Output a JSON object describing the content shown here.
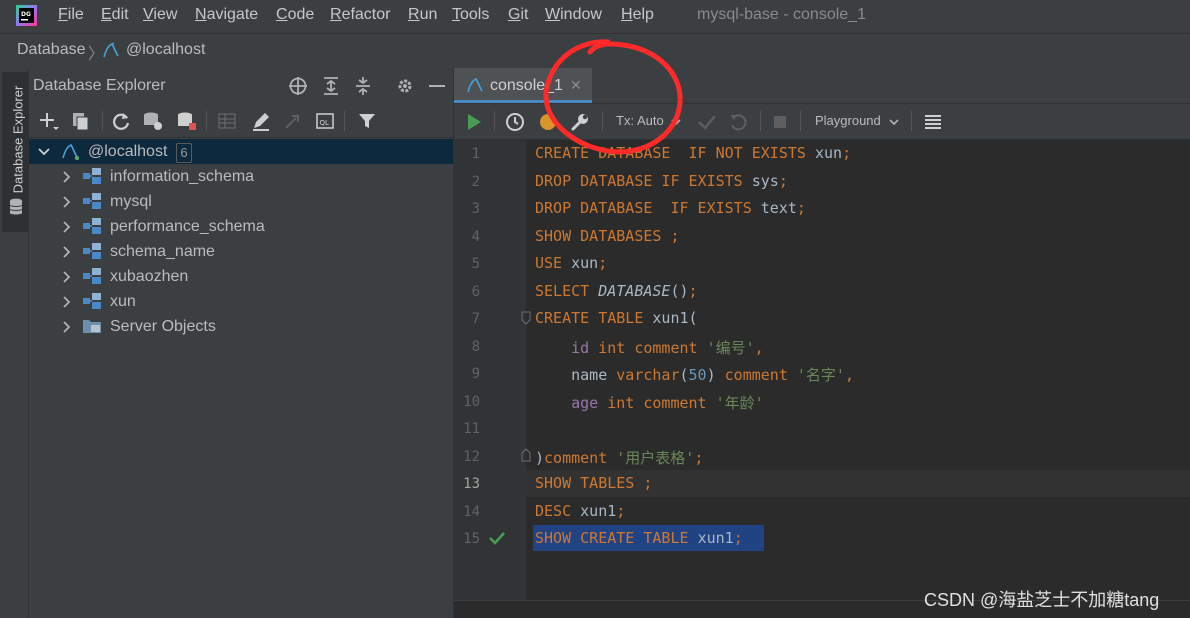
{
  "window": {
    "title": "mysql-base - console_1",
    "menu": [
      {
        "label": "File",
        "mn": "F",
        "rest": "ile"
      },
      {
        "label": "Edit",
        "mn": "E",
        "rest": "dit"
      },
      {
        "label": "View",
        "mn": "V",
        "rest": "iew"
      },
      {
        "label": "Navigate",
        "mn": "N",
        "rest": "avigate"
      },
      {
        "label": "Code",
        "mn": "C",
        "rest": "ode"
      },
      {
        "label": "Refactor",
        "mn": "R",
        "rest": "efactor"
      },
      {
        "label": "Run",
        "mn": "R",
        "rest": "un"
      },
      {
        "label": "Tools",
        "mn": "T",
        "rest": "ools"
      },
      {
        "label": "Git",
        "mn": "G",
        "rest": "it"
      },
      {
        "label": "Window",
        "mn": "W",
        "rest": "indow"
      },
      {
        "label": "Help",
        "mn": "H",
        "rest": "elp"
      }
    ]
  },
  "breadcrumb": {
    "database": "Database",
    "host": "@localhost"
  },
  "side_stripe": {
    "label": "Database Explorer"
  },
  "explorer": {
    "title": "Database Explorer",
    "root": {
      "label": "@localhost",
      "count": "6"
    },
    "items": [
      {
        "label": "information_schema"
      },
      {
        "label": "mysql"
      },
      {
        "label": "performance_schema"
      },
      {
        "label": "schema_name"
      },
      {
        "label": "xubaozhen"
      },
      {
        "label": "xun"
      },
      {
        "label": "Server Objects"
      }
    ]
  },
  "editor": {
    "tab_label": "console_1",
    "tx_mode": "Tx: Auto",
    "playground": "Playground",
    "current_line": 13,
    "lines": [
      {
        "n": "1",
        "segs": [
          [
            "kw",
            "CREATE DATABASE  IF NOT EXISTS "
          ],
          [
            "id",
            "xun"
          ],
          [
            "kw",
            ";"
          ]
        ]
      },
      {
        "n": "2",
        "segs": [
          [
            "kw",
            "DROP DATABASE IF EXISTS "
          ],
          [
            "id",
            "sys"
          ],
          [
            "kw",
            ";"
          ]
        ]
      },
      {
        "n": "3",
        "segs": [
          [
            "kw",
            "DROP DATABASE  IF EXISTS "
          ],
          [
            "id",
            "text"
          ],
          [
            "kw",
            ";"
          ]
        ]
      },
      {
        "n": "4",
        "segs": [
          [
            "kw",
            "SHOW DATABASES ;"
          ]
        ]
      },
      {
        "n": "5",
        "segs": [
          [
            "kw",
            "USE "
          ],
          [
            "id",
            "xun"
          ],
          [
            "kw",
            ";"
          ]
        ]
      },
      {
        "n": "6",
        "segs": [
          [
            "kw",
            "SELECT "
          ],
          [
            "fn",
            "DATABASE"
          ],
          [
            "id",
            "()"
          ],
          [
            "kw",
            ";"
          ]
        ]
      },
      {
        "n": "7",
        "segs": [
          [
            "kw",
            "CREATE TABLE "
          ],
          [
            "id",
            "xun1("
          ]
        ]
      },
      {
        "n": "8",
        "segs": [
          [
            "id",
            "    "
          ],
          [
            "col",
            "id"
          ],
          [
            "kw",
            " int comment "
          ],
          [
            "str",
            "'编号'"
          ],
          [
            "kw",
            ","
          ]
        ]
      },
      {
        "n": "9",
        "segs": [
          [
            "id",
            "    name "
          ],
          [
            "kw",
            "varchar"
          ],
          [
            "id",
            "("
          ],
          [
            "num",
            "50"
          ],
          [
            "id",
            ") "
          ],
          [
            "kw",
            "comment "
          ],
          [
            "str",
            "'名字'"
          ],
          [
            "kw",
            ","
          ]
        ]
      },
      {
        "n": "10",
        "segs": [
          [
            "id",
            "    "
          ],
          [
            "col",
            "age"
          ],
          [
            "kw",
            " int comment "
          ],
          [
            "str",
            "'年龄'"
          ]
        ]
      },
      {
        "n": "11",
        "segs": []
      },
      {
        "n": "12",
        "segs": [
          [
            "id",
            ")"
          ],
          [
            "kw",
            "comment "
          ],
          [
            "str",
            "'用户表格'"
          ],
          [
            "kw",
            ";"
          ]
        ]
      },
      {
        "n": "13",
        "segs": [
          [
            "kw",
            "SHOW TABLES ;"
          ]
        ]
      },
      {
        "n": "14",
        "segs": [
          [
            "kw",
            "DESC "
          ],
          [
            "id",
            "xun1"
          ],
          [
            "kw",
            ";"
          ]
        ]
      },
      {
        "n": "15",
        "segs": [
          [
            "kw",
            "SHOW CREATE TABLE "
          ],
          [
            "id",
            "xun1"
          ],
          [
            "kw",
            ";"
          ]
        ]
      }
    ]
  },
  "watermark": "CSDN @海盐芝士不加糖tang",
  "colors": {
    "accent": "#4a88c7",
    "selection": "#214283",
    "keyword": "#cc7832",
    "string": "#6a8759",
    "annotation": "#ff2a2a"
  }
}
